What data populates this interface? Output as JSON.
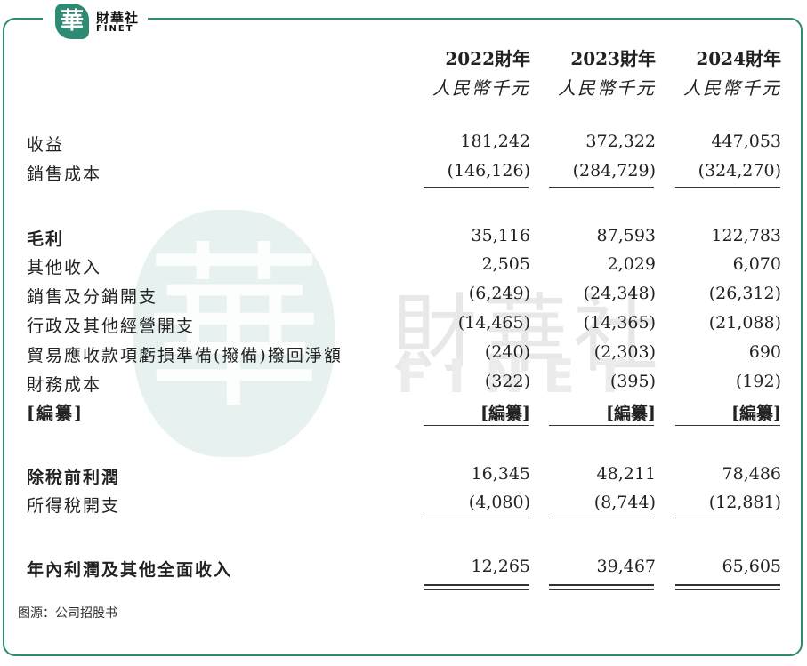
{
  "brand": {
    "logo_glyph": "華",
    "name_cn": "財華社",
    "name_en": "FINET"
  },
  "watermark": {
    "glyph": "華",
    "cn": "財華社",
    "en": "FINET"
  },
  "colors": {
    "accent": "#2f8a74"
  },
  "header": {
    "years": [
      "2022財年",
      "2023財年",
      "2024財年"
    ],
    "unit": "人民幣千元"
  },
  "rows": [
    {
      "label": "收益",
      "values": [
        "181,242",
        "372,322",
        "447,053"
      ]
    },
    {
      "label": "銷售成本",
      "values": [
        "(146,126)",
        "(284,729)",
        "(324,270)"
      ]
    },
    {
      "label": "毛利",
      "values": [
        "35,116",
        "87,593",
        "122,783"
      ]
    },
    {
      "label": "其他收入",
      "values": [
        "2,505",
        "2,029",
        "6,070"
      ]
    },
    {
      "label": "銷售及分銷開支",
      "values": [
        "(6,249)",
        "(24,348)",
        "(26,312)"
      ]
    },
    {
      "label": "行政及其他經營開支",
      "values": [
        "(14,465)",
        "(14,365)",
        "(21,088)"
      ]
    },
    {
      "label": "貿易應收款項虧損準備(撥備)撥回淨額",
      "values": [
        "(240)",
        "(2,303)",
        "690"
      ]
    },
    {
      "label": "財務成本",
      "values": [
        "(322)",
        "(395)",
        "(192)"
      ]
    },
    {
      "label": "[編纂]",
      "values": [
        "[編纂]",
        "[編纂]",
        "[編纂]"
      ]
    },
    {
      "label": "除稅前利潤",
      "values": [
        "16,345",
        "48,211",
        "78,486"
      ]
    },
    {
      "label": "所得稅開支",
      "values": [
        "(4,080)",
        "(8,744)",
        "(12,881)"
      ]
    },
    {
      "label": "年內利潤及其他全面收入",
      "values": [
        "12,265",
        "39,467",
        "65,605"
      ]
    }
  ],
  "source": "图源：公司招股书"
}
